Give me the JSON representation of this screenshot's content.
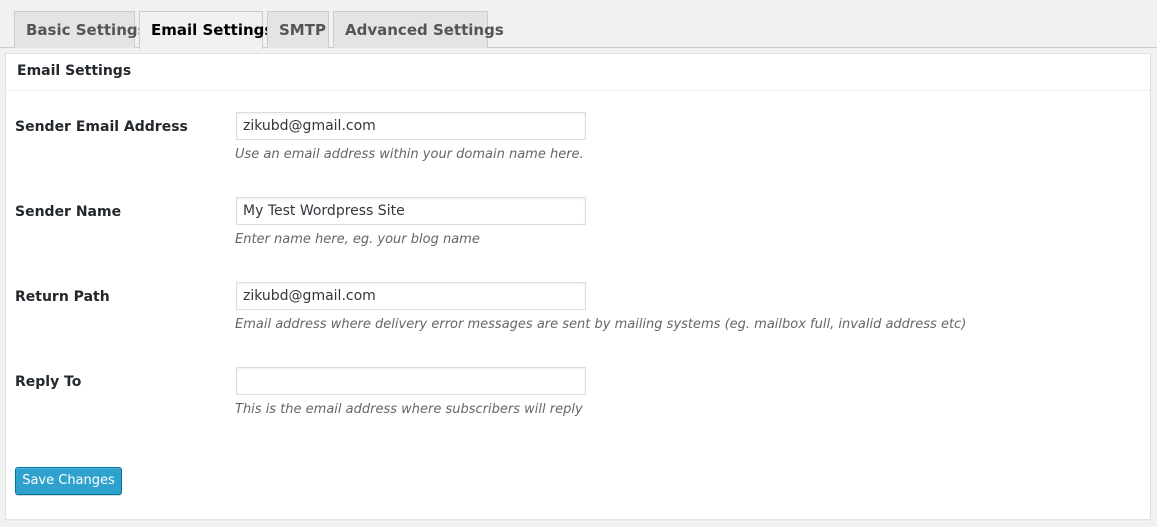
{
  "tabs": [
    {
      "label": "Basic Settings",
      "active": false
    },
    {
      "label": "Email Settings",
      "active": true
    },
    {
      "label": "SMTP",
      "active": false
    },
    {
      "label": "Advanced Settings",
      "active": false
    }
  ],
  "panel": {
    "title": "Email Settings",
    "fields": [
      {
        "label": "Sender Email Address",
        "value": "zikubd@gmail.com",
        "description": "Use an email address within your domain name here."
      },
      {
        "label": "Sender Name",
        "value": "My Test Wordpress Site",
        "description": "Enter name here, eg. your blog name"
      },
      {
        "label": "Return Path",
        "value": "zikubd@gmail.com",
        "description": "Email address where delivery error messages are sent by mailing systems (eg. mailbox full, invalid address etc)"
      },
      {
        "label": "Reply To",
        "value": "",
        "description": "This is the email address where subscribers will reply"
      }
    ],
    "save_label": "Save Changes"
  },
  "colors": {
    "accent": "#2ea2cc",
    "accent_border": "#0074a2",
    "background": "#f1f1f1",
    "panel": "#ffffff"
  }
}
